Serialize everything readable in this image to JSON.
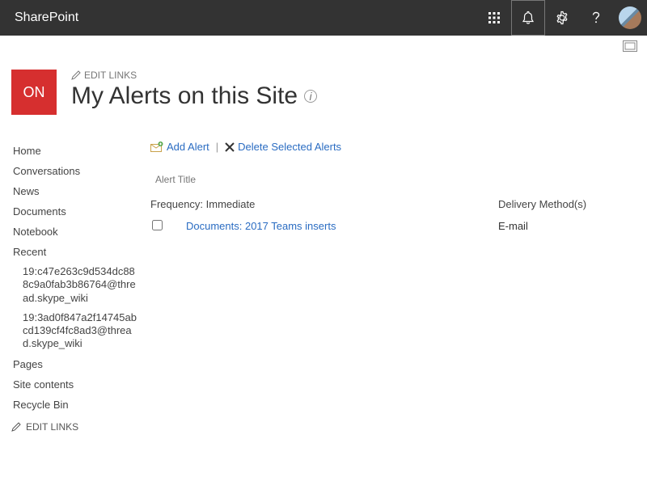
{
  "topbar": {
    "brand": "SharePoint"
  },
  "site": {
    "logo_text": "ON",
    "edit_links_label": "EDIT LINKS",
    "page_title": "My Alerts on this Site"
  },
  "leftnav": {
    "items": [
      {
        "label": "Home"
      },
      {
        "label": "Conversations"
      },
      {
        "label": "News"
      },
      {
        "label": "Documents"
      },
      {
        "label": "Notebook"
      },
      {
        "label": "Recent"
      }
    ],
    "recent_children": [
      {
        "label": "19:c47e263c9d534dc888c9a0fab3b86764@thread.skype_wiki"
      },
      {
        "label": "19:3ad0f847a2f14745abcd139cf4fc8ad3@thread.skype_wiki"
      }
    ],
    "items_after": [
      {
        "label": "Pages"
      },
      {
        "label": "Site contents"
      },
      {
        "label": "Recycle Bin"
      }
    ],
    "edit_links_label": "EDIT LINKS"
  },
  "toolbar": {
    "add_alert": "Add Alert",
    "delete_selected": "Delete Selected Alerts"
  },
  "table": {
    "alert_title_header": "Alert Title",
    "frequency_label": "Frequency: Immediate",
    "delivery_header": "Delivery Method(s)",
    "rows": [
      {
        "name": "Documents: 2017 Teams inserts",
        "method": "E-mail"
      }
    ]
  }
}
